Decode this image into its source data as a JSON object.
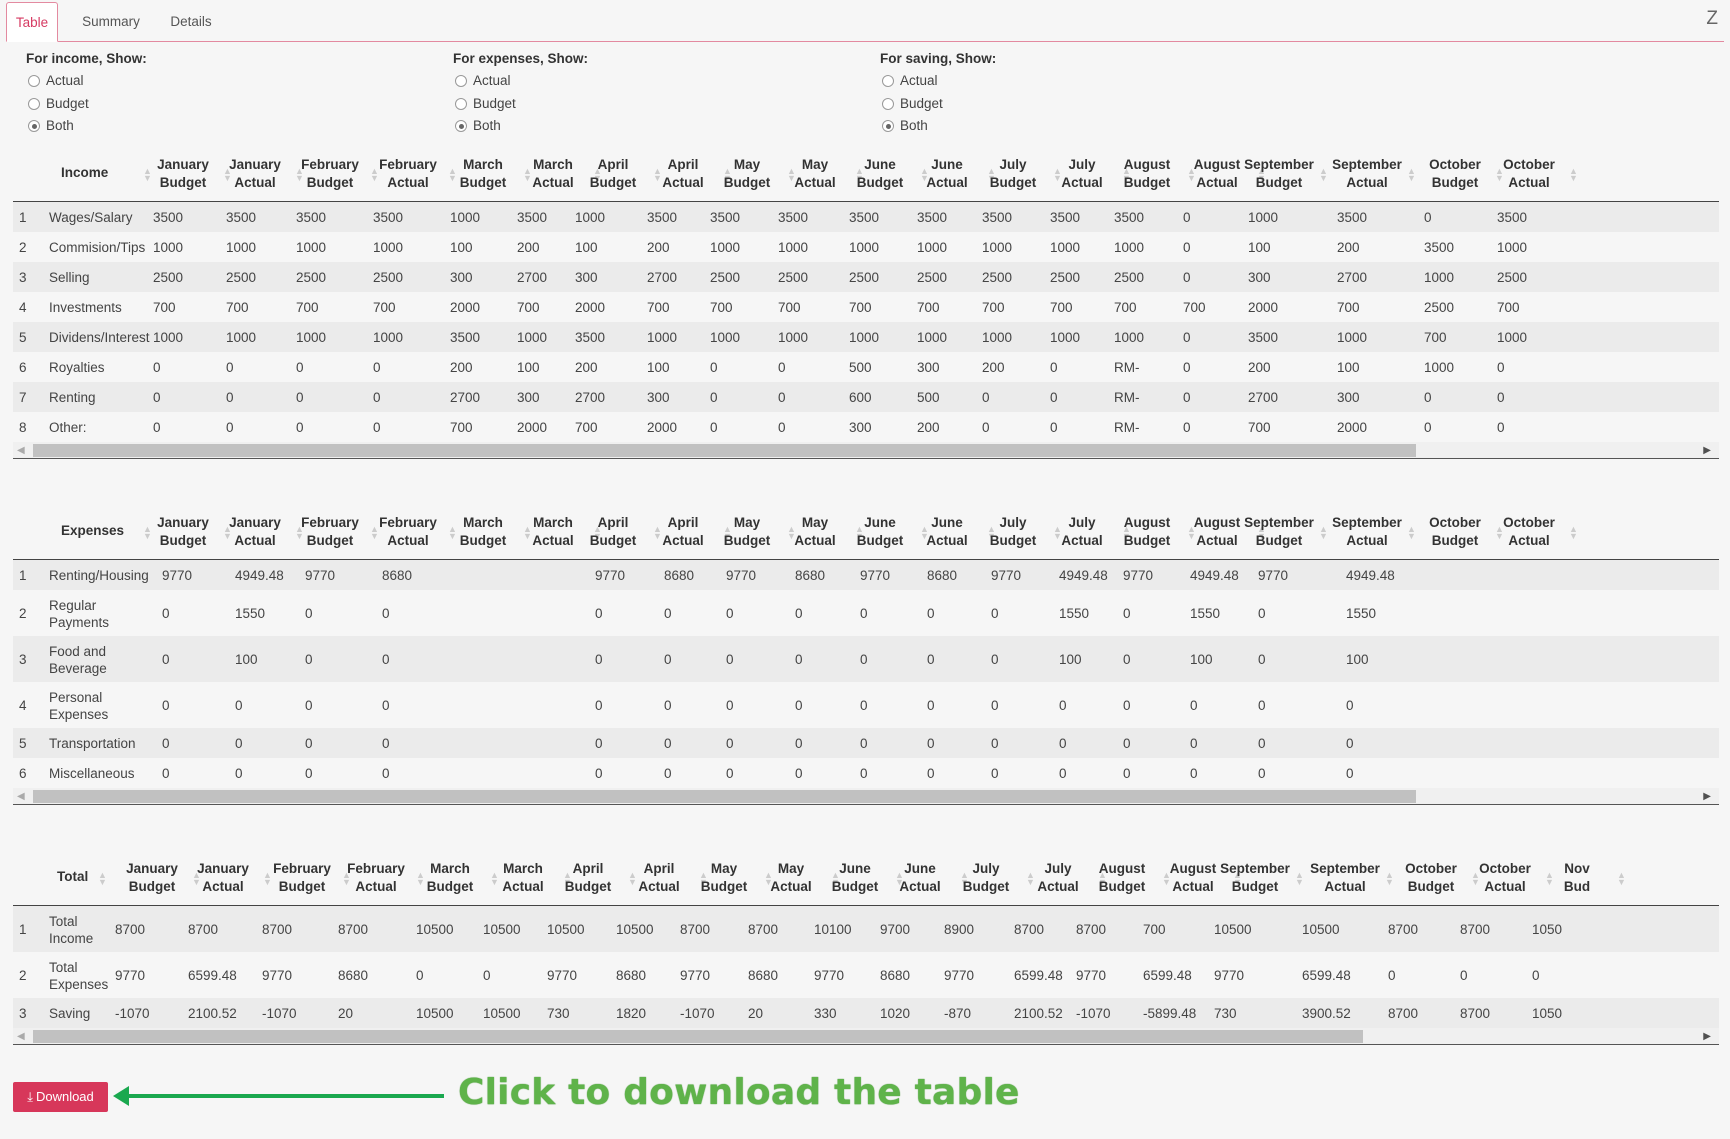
{
  "tabs": {
    "table": "Table",
    "summary": "Summary",
    "details": "Details",
    "z": "Z"
  },
  "radio_groups": [
    {
      "title": "For income, Show:",
      "options": [
        "Actual",
        "Budget",
        "Both"
      ],
      "selected": "Both"
    },
    {
      "title": "For expenses, Show:",
      "options": [
        "Actual",
        "Budget",
        "Both"
      ],
      "selected": "Both"
    },
    {
      "title": "For saving, Show:",
      "options": [
        "Actual",
        "Budget",
        "Both"
      ],
      "selected": "Both"
    }
  ],
  "income_table": {
    "first_header": "Income",
    "columns": [
      "January\nBudget",
      "January\nActual",
      "February\nBudget",
      "February\nActual",
      "March\nBudget",
      "March\nActual",
      "April\nBudget",
      "April\nActual",
      "May\nBudget",
      "May\nActual",
      "June\nBudget",
      "June\nActual",
      "July\nBudget",
      "July\nActual",
      "August\nBudget",
      "August\nActual",
      "September\nBudget",
      "September\nActual",
      "October\nBudget",
      "October\nActual"
    ],
    "rows": [
      {
        "n": "1",
        "label": "Wages/Salary",
        "values": [
          "3500",
          "3500",
          "3500",
          "3500",
          "1000",
          "3500",
          "1000",
          "3500",
          "3500",
          "3500",
          "3500",
          "3500",
          "3500",
          "3500",
          "3500",
          "0",
          "1000",
          "3500",
          "0",
          "3500"
        ]
      },
      {
        "n": "2",
        "label": "Commision/Tips",
        "values": [
          "1000",
          "1000",
          "1000",
          "1000",
          "100",
          "200",
          "100",
          "200",
          "1000",
          "1000",
          "1000",
          "1000",
          "1000",
          "1000",
          "1000",
          "0",
          "100",
          "200",
          "3500",
          "1000"
        ]
      },
      {
        "n": "3",
        "label": "Selling",
        "values": [
          "2500",
          "2500",
          "2500",
          "2500",
          "300",
          "2700",
          "300",
          "2700",
          "2500",
          "2500",
          "2500",
          "2500",
          "2500",
          "2500",
          "2500",
          "0",
          "300",
          "2700",
          "1000",
          "2500"
        ]
      },
      {
        "n": "4",
        "label": "Investments",
        "values": [
          "700",
          "700",
          "700",
          "700",
          "2000",
          "700",
          "2000",
          "700",
          "700",
          "700",
          "700",
          "700",
          "700",
          "700",
          "700",
          "700",
          "2000",
          "700",
          "2500",
          "700"
        ]
      },
      {
        "n": "5",
        "label": "Dividens/Interest",
        "values": [
          "1000",
          "1000",
          "1000",
          "1000",
          "3500",
          "1000",
          "3500",
          "1000",
          "1000",
          "1000",
          "1000",
          "1000",
          "1000",
          "1000",
          "1000",
          "0",
          "3500",
          "1000",
          "700",
          "1000"
        ]
      },
      {
        "n": "6",
        "label": "Royalties",
        "values": [
          "0",
          "0",
          "0",
          "0",
          "200",
          "100",
          "200",
          "100",
          "0",
          "0",
          "500",
          "300",
          "200",
          "0",
          "RM-",
          "0",
          "200",
          "100",
          "1000",
          "0"
        ]
      },
      {
        "n": "7",
        "label": "Renting",
        "values": [
          "0",
          "0",
          "0",
          "0",
          "2700",
          "300",
          "2700",
          "300",
          "0",
          "0",
          "600",
          "500",
          "0",
          "0",
          "RM-",
          "0",
          "2700",
          "300",
          "0",
          "0"
        ]
      },
      {
        "n": "8",
        "label": "Other:",
        "values": [
          "0",
          "0",
          "0",
          "0",
          "700",
          "2000",
          "700",
          "2000",
          "0",
          "0",
          "300",
          "200",
          "0",
          "0",
          "RM-",
          "0",
          "700",
          "2000",
          "0",
          "0"
        ]
      }
    ]
  },
  "expenses_table": {
    "first_header": "Expenses",
    "columns": [
      "January\nBudget",
      "January\nActual",
      "February\nBudget",
      "February\nActual",
      "March\nBudget",
      "March\nActual",
      "April\nBudget",
      "April\nActual",
      "May\nBudget",
      "May\nActual",
      "June\nBudget",
      "June\nActual",
      "July\nBudget",
      "July\nActual",
      "August\nBudget",
      "August\nActual",
      "September\nBudget",
      "September\nActual",
      "October\nBudget",
      "October\nActual"
    ],
    "rows": [
      {
        "n": "1",
        "label": "Renting/Housing",
        "values": [
          "9770",
          "4949.48",
          "9770",
          "8680",
          "",
          "",
          "9770",
          "8680",
          "9770",
          "8680",
          "9770",
          "8680",
          "9770",
          "4949.48",
          "9770",
          "4949.48",
          "9770",
          "4949.48",
          "",
          ""
        ]
      },
      {
        "n": "2",
        "label": "Regular\nPayments",
        "values": [
          "0",
          "1550",
          "0",
          "0",
          "",
          "",
          "0",
          "0",
          "0",
          "0",
          "0",
          "0",
          "0",
          "1550",
          "0",
          "1550",
          "0",
          "1550",
          "",
          ""
        ]
      },
      {
        "n": "3",
        "label": "Food and\nBeverage",
        "values": [
          "0",
          "100",
          "0",
          "0",
          "",
          "",
          "0",
          "0",
          "0",
          "0",
          "0",
          "0",
          "0",
          "100",
          "0",
          "100",
          "0",
          "100",
          "",
          ""
        ]
      },
      {
        "n": "4",
        "label": "Personal\nExpenses",
        "values": [
          "0",
          "0",
          "0",
          "0",
          "",
          "",
          "0",
          "0",
          "0",
          "0",
          "0",
          "0",
          "0",
          "0",
          "0",
          "0",
          "0",
          "0",
          "",
          ""
        ]
      },
      {
        "n": "5",
        "label": "Transportation",
        "values": [
          "0",
          "0",
          "0",
          "0",
          "",
          "",
          "0",
          "0",
          "0",
          "0",
          "0",
          "0",
          "0",
          "0",
          "0",
          "0",
          "0",
          "0",
          "",
          ""
        ]
      },
      {
        "n": "6",
        "label": "Miscellaneous",
        "values": [
          "0",
          "0",
          "0",
          "0",
          "",
          "",
          "0",
          "0",
          "0",
          "0",
          "0",
          "0",
          "0",
          "0",
          "0",
          "0",
          "0",
          "0",
          "",
          ""
        ]
      }
    ]
  },
  "total_table": {
    "first_header": "Total",
    "columns": [
      "January\nBudget",
      "January\nActual",
      "February\nBudget",
      "February\nActual",
      "March\nBudget",
      "March\nActual",
      "April\nBudget",
      "April\nActual",
      "May\nBudget",
      "May\nActual",
      "June\nBudget",
      "June\nActual",
      "July\nBudget",
      "July\nActual",
      "August\nBudget",
      "August\nActual",
      "September\nBudget",
      "September\nActual",
      "October\nBudget",
      "October\nActual",
      "Nov\nBud"
    ],
    "rows": [
      {
        "n": "1",
        "label": "Total\nIncome",
        "values": [
          "8700",
          "8700",
          "8700",
          "8700",
          "10500",
          "10500",
          "10500",
          "10500",
          "8700",
          "8700",
          "10100",
          "9700",
          "8900",
          "8700",
          "8700",
          "700",
          "10500",
          "10500",
          "8700",
          "8700",
          "1050"
        ]
      },
      {
        "n": "2",
        "label": "Total\nExpenses",
        "values": [
          "9770",
          "6599.48",
          "9770",
          "8680",
          "0",
          "0",
          "9770",
          "8680",
          "9770",
          "8680",
          "9770",
          "8680",
          "9770",
          "6599.48",
          "9770",
          "6599.48",
          "9770",
          "6599.48",
          "0",
          "0",
          "0"
        ]
      },
      {
        "n": "3",
        "label": "Saving",
        "values": [
          "-1070",
          "2100.52",
          "-1070",
          "20",
          "10500",
          "10500",
          "730",
          "1820",
          "-1070",
          "20",
          "330",
          "1020",
          "-870",
          "2100.52",
          "-1070",
          "-5899.48",
          "730",
          "3900.52",
          "8700",
          "8700",
          "1050"
        ]
      }
    ]
  },
  "download": {
    "label": "Download",
    "icon": "download-icon"
  },
  "annotation": {
    "text": "Click to download the table",
    "color": "#5fb34a"
  },
  "colors": {
    "accent": "#d7375a",
    "arrow": "#1aa84f"
  }
}
